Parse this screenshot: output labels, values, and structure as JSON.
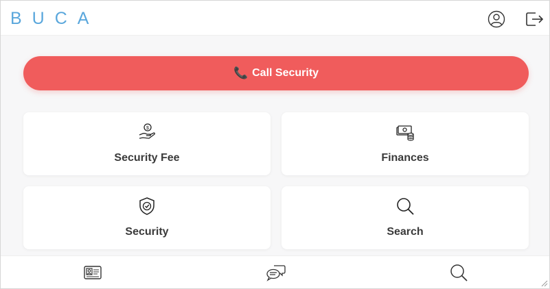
{
  "app": {
    "logo_text": "BUCA"
  },
  "header": {
    "profile_icon": "user-circle-icon",
    "logout_icon": "logout-icon"
  },
  "call_button": {
    "label": "Call Security",
    "icon": "phone-icon",
    "color": "#f05c5c"
  },
  "cards": [
    {
      "label": "Security Fee",
      "icon": "hand-coin-icon"
    },
    {
      "label": "Finances",
      "icon": "money-stack-icon"
    },
    {
      "label": "Security",
      "icon": "shield-check-icon"
    },
    {
      "label": "Search",
      "icon": "search-icon"
    }
  ],
  "bottom_nav": [
    {
      "icon": "id-card-icon"
    },
    {
      "icon": "chat-bubbles-icon"
    },
    {
      "icon": "search-icon"
    }
  ],
  "colors": {
    "brand": "#5aa7dc",
    "accent": "#f05c5c",
    "background": "#f7f7f8"
  }
}
